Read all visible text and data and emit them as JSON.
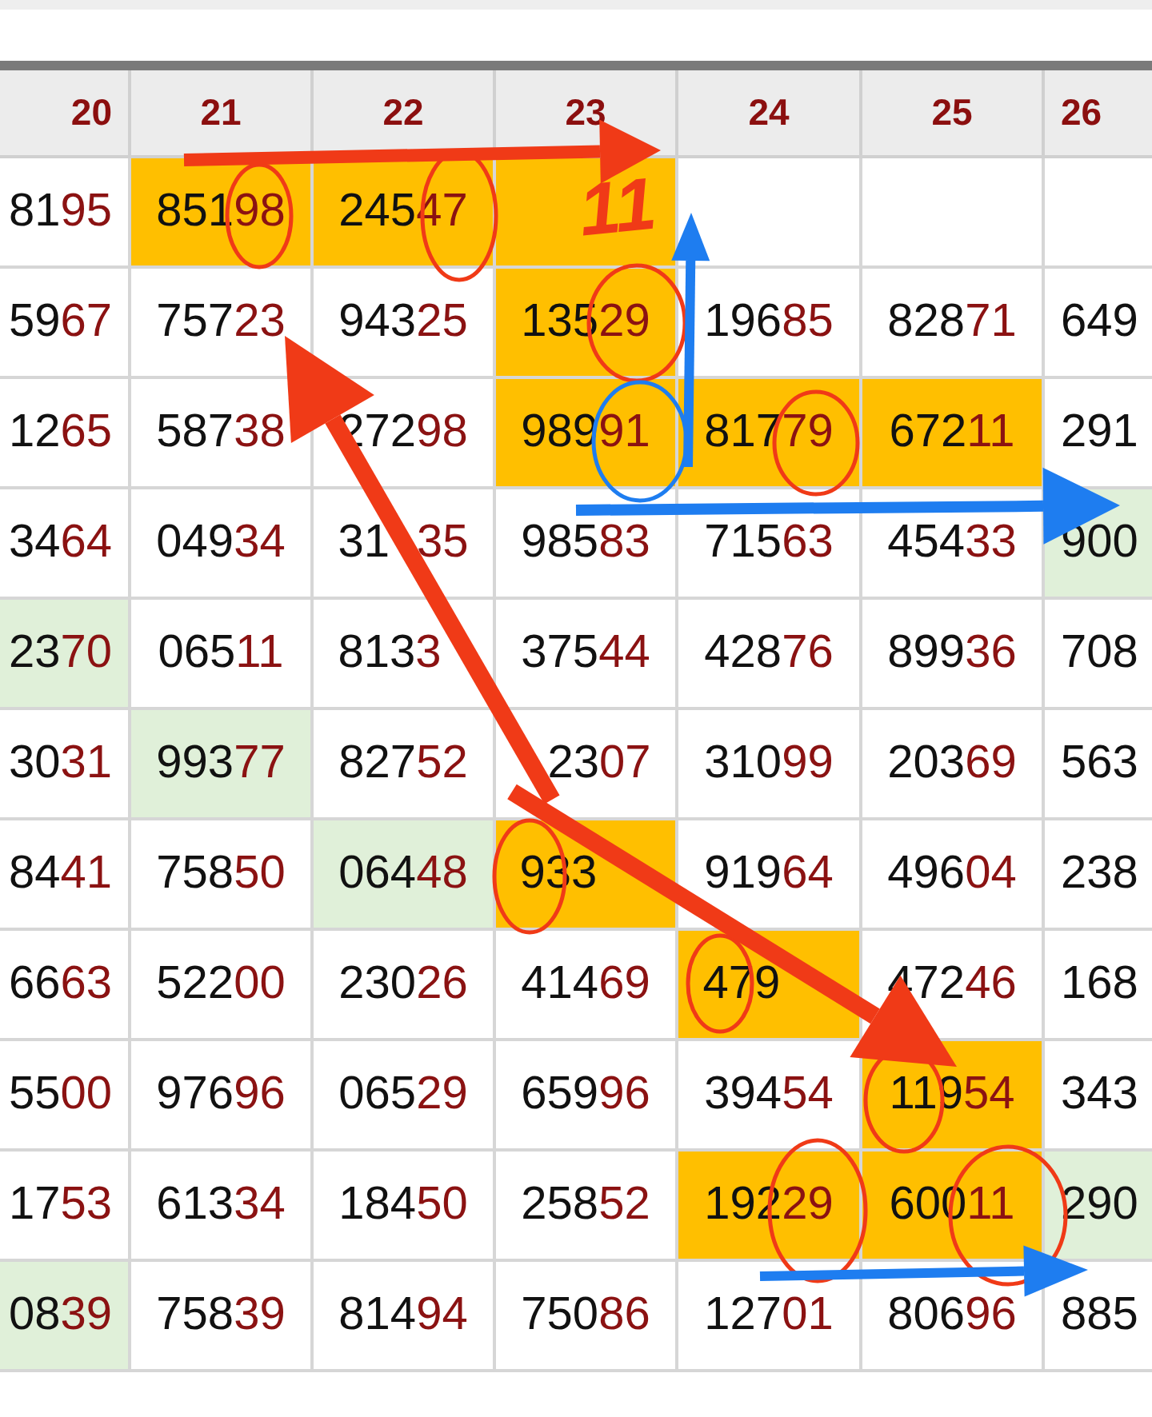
{
  "table": {
    "columns": [
      "20",
      "21",
      "22",
      "23",
      "24",
      "25",
      "26"
    ],
    "rows": [
      {
        "cells": [
          {
            "head": "81",
            "tail": "95",
            "color": "#ffffff"
          },
          {
            "head": "851",
            "tail": "98",
            "color": "#ffbf00"
          },
          {
            "head": "245",
            "tail": "47",
            "color": "#ffbf00"
          },
          {
            "color": "#ffbf00"
          },
          {
            "color": "#ffffff"
          },
          {
            "color": "#ffffff"
          },
          {
            "color": "#ffffff"
          }
        ]
      },
      {
        "cells": [
          {
            "head": "59",
            "tail": "67",
            "color": "#ffffff"
          },
          {
            "head": "757",
            "tail": "23",
            "color": "#ffffff"
          },
          {
            "head": "943",
            "tail": "25",
            "color": "#ffffff"
          },
          {
            "head": "135",
            "tail": "29",
            "color": "#ffbf00"
          },
          {
            "head": "196",
            "tail": "85",
            "color": "#ffffff"
          },
          {
            "head": "828",
            "tail": "71",
            "color": "#ffffff"
          },
          {
            "head": "649",
            "color": "#ffffff"
          }
        ]
      },
      {
        "cells": [
          {
            "head": "12",
            "tail": "65",
            "color": "#ffffff"
          },
          {
            "head": "587",
            "tail": "38",
            "color": "#ffffff"
          },
          {
            "head": "272",
            "tail": "98",
            "color": "#ffffff"
          },
          {
            "head": "989",
            "tail": "91",
            "color": "#ffbf00"
          },
          {
            "head": "817",
            "tail": "79",
            "color": "#ffbf00"
          },
          {
            "head": "672",
            "tail": "11",
            "color": "#ffbf00"
          },
          {
            "head": "291",
            "color": "#ffffff"
          }
        ]
      },
      {
        "cells": [
          {
            "head": "34",
            "tail": "64",
            "color": "#ffffff"
          },
          {
            "head": "049",
            "tail": "34",
            "color": "#ffffff"
          },
          {
            "head": "31",
            "tail": "35",
            "covered_middle": true,
            "color": "#ffffff"
          },
          {
            "head": "985",
            "tail": "83",
            "color": "#ffffff"
          },
          {
            "head": "715",
            "tail": "63",
            "color": "#ffffff"
          },
          {
            "head": "454",
            "tail": "33",
            "color": "#ffffff"
          },
          {
            "head": "900",
            "color": "#e0f0d9"
          }
        ]
      },
      {
        "cells": [
          {
            "head": "23",
            "tail": "70",
            "color": "#e0f0d9"
          },
          {
            "head": "065",
            "tail": "11",
            "color": "#ffffff"
          },
          {
            "head": "813",
            "tail": "3",
            "covered_end": true,
            "color": "#ffffff"
          },
          {
            "head": "375",
            "tail": "44",
            "color": "#ffffff"
          },
          {
            "head": "428",
            "tail": "76",
            "color": "#ffffff"
          },
          {
            "head": "899",
            "tail": "36",
            "color": "#ffffff"
          },
          {
            "head": "708",
            "color": "#ffffff"
          }
        ]
      },
      {
        "cells": [
          {
            "head": "30",
            "tail": "31",
            "color": "#ffffff"
          },
          {
            "head": "993",
            "tail": "77",
            "color": "#e0f0d9"
          },
          {
            "head": "827",
            "tail": "52",
            "color": "#ffffff"
          },
          {
            "head": "23",
            "tail": "07",
            "covered_start": true,
            "color": "#ffffff"
          },
          {
            "head": "310",
            "tail": "99",
            "color": "#ffffff"
          },
          {
            "head": "203",
            "tail": "69",
            "color": "#ffffff"
          },
          {
            "head": "563",
            "color": "#ffffff"
          }
        ]
      },
      {
        "cells": [
          {
            "head": "84",
            "tail": "41",
            "color": "#ffffff"
          },
          {
            "head": "758",
            "tail": "50",
            "color": "#ffffff"
          },
          {
            "head": "064",
            "tail": "48",
            "color": "#e0f0d9"
          },
          {
            "head": "933",
            "covered_end": true,
            "color": "#ffbf00"
          },
          {
            "head": "919",
            "tail": "64",
            "color": "#ffffff"
          },
          {
            "head": "496",
            "tail": "04",
            "color": "#ffffff"
          },
          {
            "head": "238",
            "color": "#ffffff"
          }
        ]
      },
      {
        "cells": [
          {
            "head": "66",
            "tail": "63",
            "color": "#ffffff"
          },
          {
            "head": "522",
            "tail": "00",
            "color": "#ffffff"
          },
          {
            "head": "230",
            "tail": "26",
            "color": "#ffffff"
          },
          {
            "head": "414",
            "tail": "69",
            "color": "#ffffff"
          },
          {
            "head": "479",
            "covered_end": true,
            "color": "#ffbf00"
          },
          {
            "head": "472",
            "tail": "46",
            "color": "#ffffff"
          },
          {
            "head": "168",
            "color": "#ffffff"
          }
        ]
      },
      {
        "cells": [
          {
            "head": "55",
            "tail": "00",
            "color": "#ffffff"
          },
          {
            "head": "976",
            "tail": "96",
            "color": "#ffffff"
          },
          {
            "head": "065",
            "tail": "29",
            "color": "#ffffff"
          },
          {
            "head": "659",
            "tail": "96",
            "color": "#ffffff"
          },
          {
            "head": "394",
            "tail": "54",
            "color": "#ffffff"
          },
          {
            "head": "119",
            "tail": "54",
            "color": "#ffbf00"
          },
          {
            "head": "343",
            "color": "#ffffff"
          }
        ]
      },
      {
        "cells": [
          {
            "head": "17",
            "tail": "53",
            "color": "#ffffff"
          },
          {
            "head": "613",
            "tail": "34",
            "color": "#ffffff"
          },
          {
            "head": "184",
            "tail": "50",
            "color": "#ffffff"
          },
          {
            "head": "258",
            "tail": "52",
            "color": "#ffffff"
          },
          {
            "head": "192",
            "tail": "29",
            "color": "#ffbf00"
          },
          {
            "head": "600",
            "tail": "11",
            "color": "#ffbf00"
          },
          {
            "head": "290",
            "color": "#e0f0d9"
          }
        ]
      },
      {
        "cells": [
          {
            "head": "08",
            "tail": "39",
            "color": "#e0f0d9"
          },
          {
            "head": "758",
            "tail": "39",
            "color": "#ffffff"
          },
          {
            "head": "814",
            "tail": "94",
            "color": "#ffffff"
          },
          {
            "head": "750",
            "tail": "86",
            "color": "#ffffff"
          },
          {
            "head": "127",
            "tail": "01",
            "color": "#ffffff"
          },
          {
            "head": "806",
            "tail": "96",
            "color": "#ffffff"
          },
          {
            "head": "885",
            "color": "#ffffff"
          }
        ]
      }
    ]
  },
  "annotation": {
    "note": "11"
  }
}
